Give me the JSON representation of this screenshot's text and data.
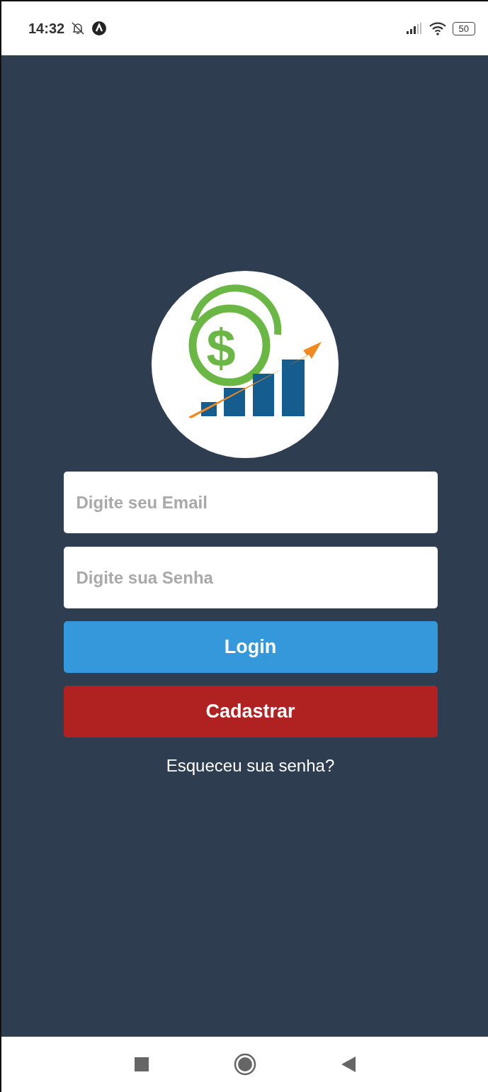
{
  "status_bar": {
    "time": "14:32",
    "battery": "50"
  },
  "logo": {
    "symbol": "$"
  },
  "form": {
    "email": {
      "placeholder": "Digite seu Email"
    },
    "password": {
      "placeholder": "Digite sua Senha"
    }
  },
  "buttons": [
    {
      "kind": "primary",
      "label": "Login"
    },
    {
      "kind": "danger",
      "label": "Cadastrar"
    }
  ],
  "forgot_link": "Esqueceu sua senha?"
}
